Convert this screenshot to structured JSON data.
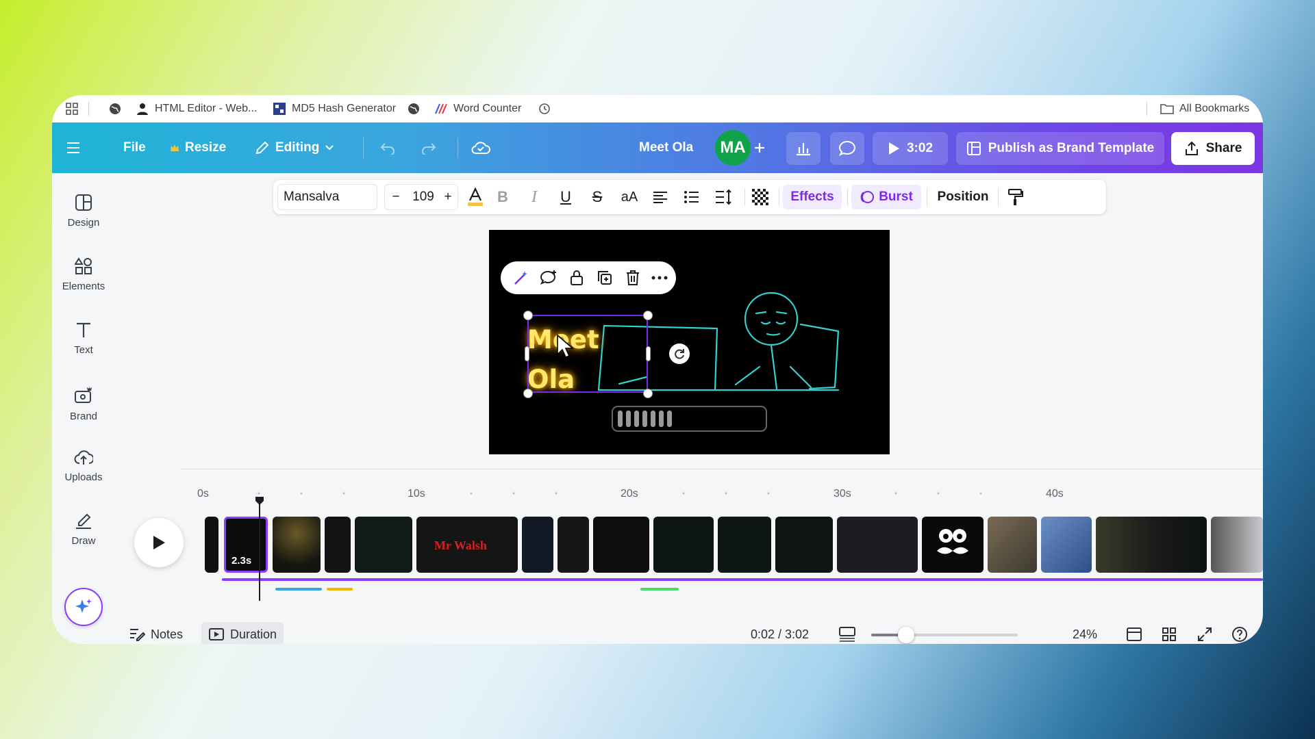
{
  "bookmarks": [
    {
      "label": "HTML Editor - Web...",
      "icon": "html-editor-icon"
    },
    {
      "label": "MD5 Hash Generator",
      "icon": "md5-icon"
    },
    {
      "label": "Word Counter",
      "icon": "word-counter-icon"
    }
  ],
  "bookmarks_all": "All Bookmarks",
  "header": {
    "file": "File",
    "resize": "Resize",
    "editing": "Editing",
    "title": "Meet Ola",
    "avatar": "MA",
    "play_time": "3:02",
    "publish": "Publish as Brand Template",
    "share": "Share"
  },
  "sidebar": [
    {
      "label": "Design",
      "icon": "design-icon"
    },
    {
      "label": "Elements",
      "icon": "elements-icon"
    },
    {
      "label": "Text",
      "icon": "text-icon"
    },
    {
      "label": "Brand",
      "icon": "brand-icon"
    },
    {
      "label": "Uploads",
      "icon": "uploads-icon"
    },
    {
      "label": "Draw",
      "icon": "draw-icon"
    }
  ],
  "format": {
    "font": "Mansalva",
    "size": "109",
    "minus": "−",
    "plus": "+",
    "case": "aA",
    "effects": "Effects",
    "burst": "Burst",
    "position": "Position"
  },
  "canvas": {
    "text_line1": "Meet",
    "text_line2": "Ola"
  },
  "timeline": {
    "ticks": [
      "0s",
      "10s",
      "20s",
      "30s",
      "40s"
    ],
    "clip_duration": "2.3s",
    "thumb_text": "Mr Walsh"
  },
  "footer": {
    "notes": "Notes",
    "duration": "Duration",
    "time": "0:02 / 3:02",
    "zoom": "24%",
    "zoom_fraction": 0.24
  },
  "colors": {
    "accent": "#8b3dff",
    "selection": "#7d2ae8",
    "glow": "#ffe86b",
    "line": "#31d3d0"
  }
}
